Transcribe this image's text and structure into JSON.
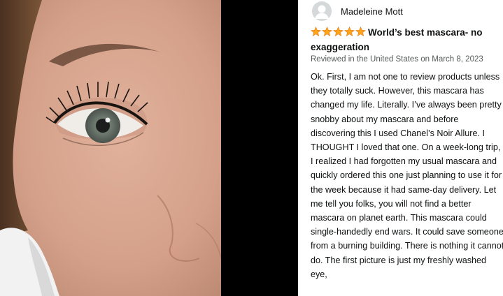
{
  "review": {
    "reviewer_name": "Madeleine Mott",
    "rating": 5,
    "rating_max": 5,
    "star_color": "#FFA41C",
    "title": "World’s best mascara- no exaggeration",
    "meta": "Reviewed in the United States on March 8, 2023",
    "body": "Ok. First, I am not one to review products unless they totally suck. However, this mascara has changed my life. Literally. I’ve always been pretty snobby about my mascara and before discovering this I used Chanel’s Noir Allure. I THOUGHT I loved that one. On a week-long trip, I realized I had forgotten my usual mascara and quickly ordered this one just planning to use it for the week because it had same-day delivery. Let me tell you folks, you will not find a better mascara on planet earth. This mascara could single-handedly end wars. It could save someone from a burning building. There is nothing it cannot do. The first picture is just my freshly washed eye,"
  },
  "icons": {
    "avatar": "default-user-avatar-icon",
    "star": "filled-star-icon"
  }
}
